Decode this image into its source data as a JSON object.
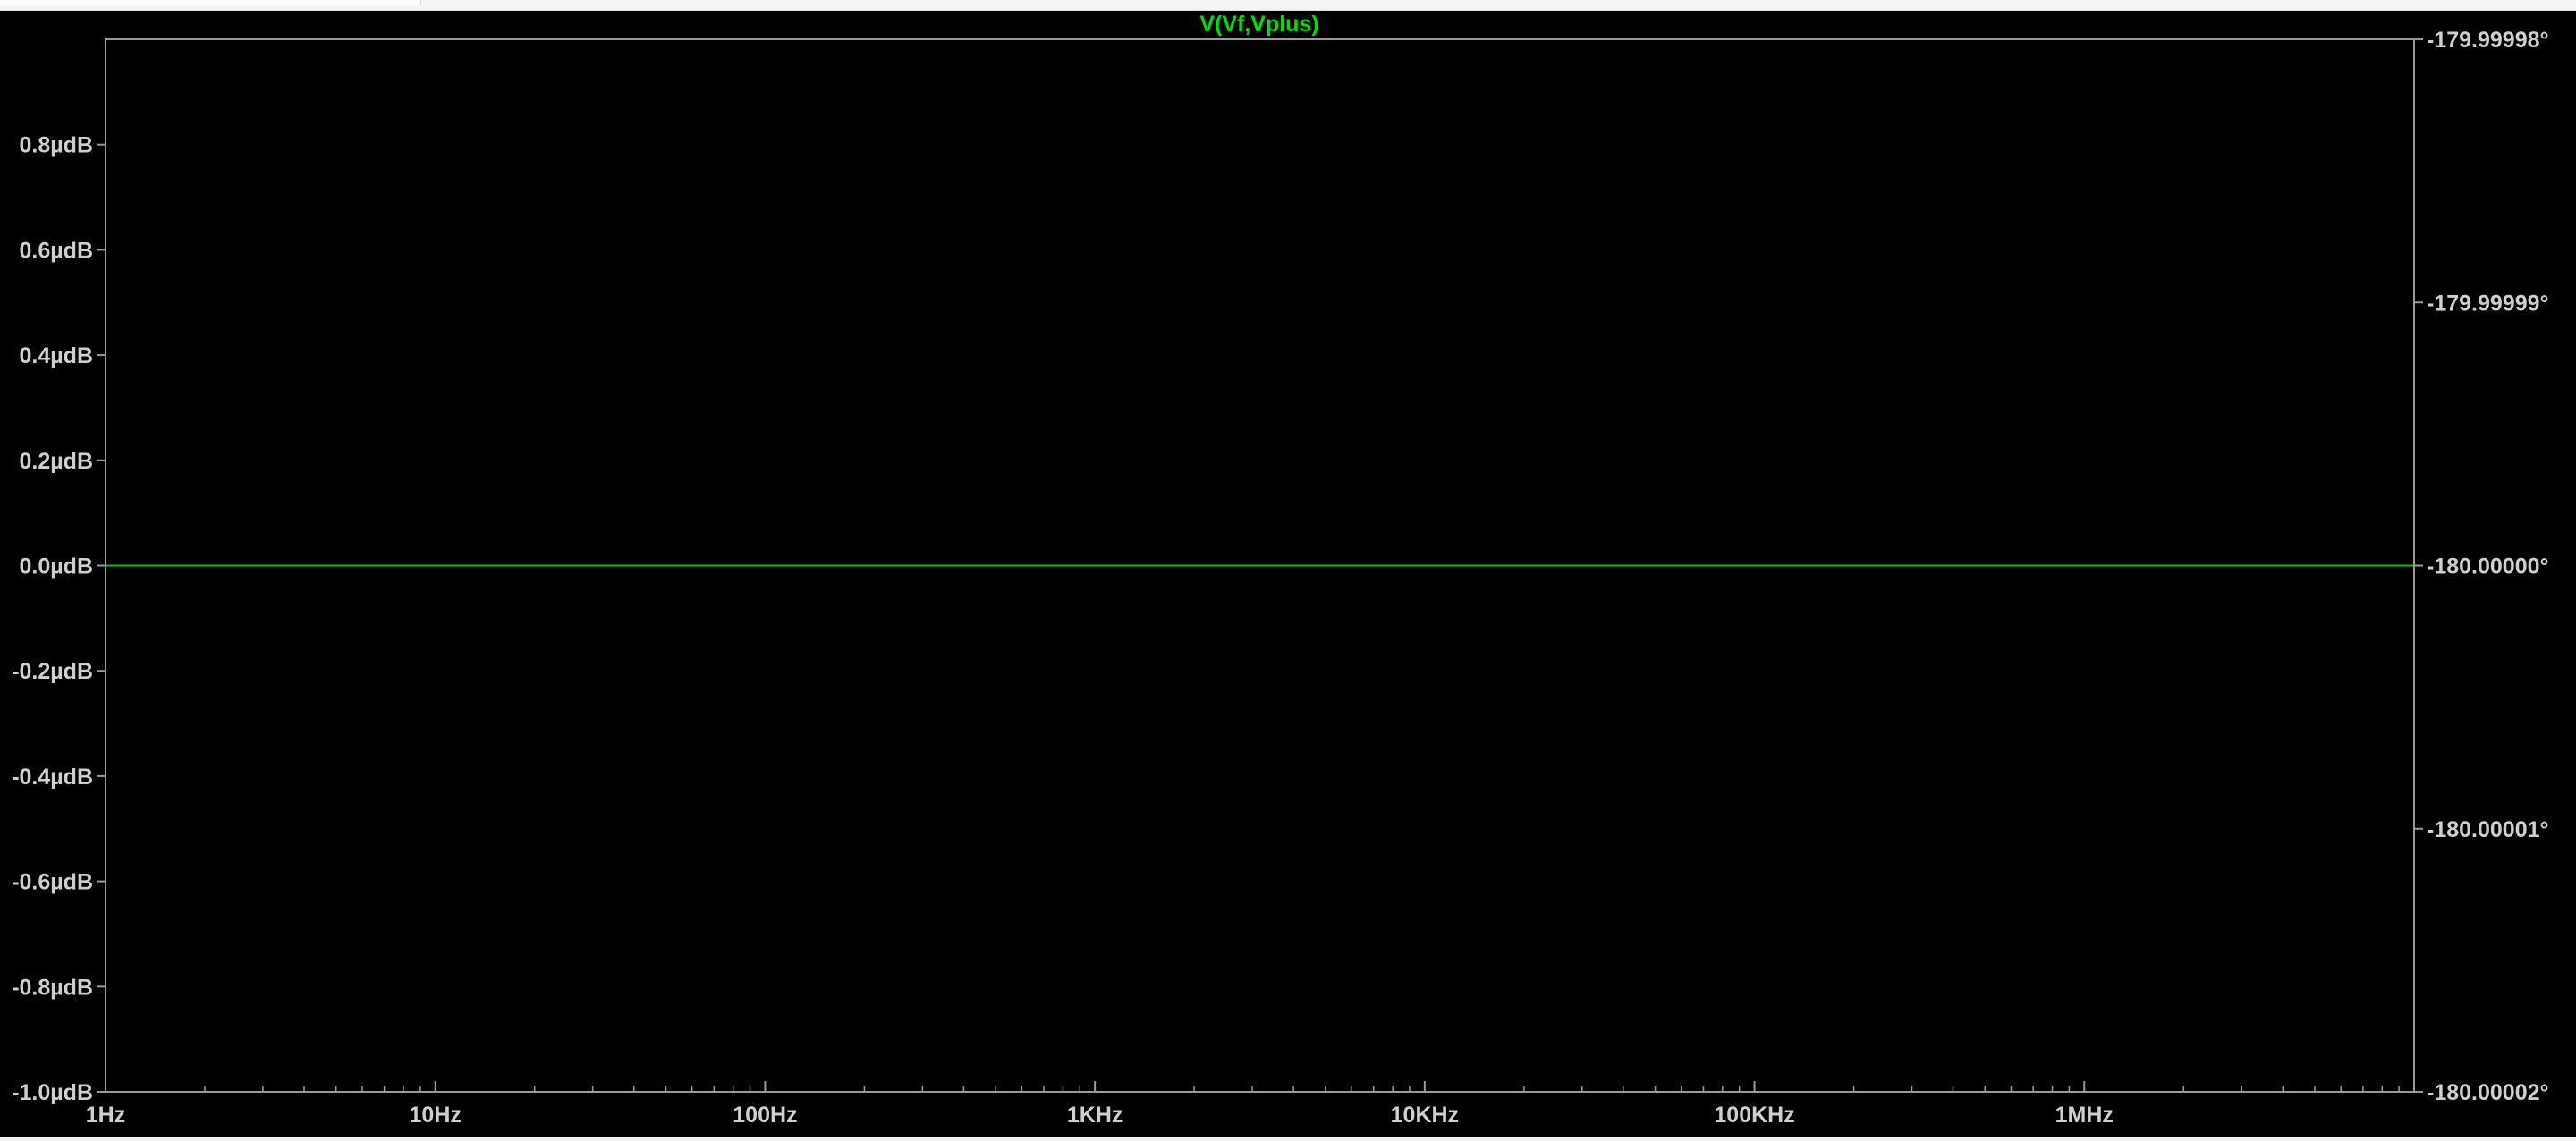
{
  "colors": {
    "background": "#000000",
    "frame": "#9a9a9a",
    "tick_label": "#cfcfcf",
    "trace": "#00c000",
    "trace_label": "#00e000"
  },
  "chart_data": {
    "type": "line",
    "title": "V(Vf,Vplus)",
    "x_scale": "log",
    "xlim": [
      1,
      10000000
    ],
    "x_ticks": [
      1,
      10,
      100,
      1000,
      10000,
      100000,
      1000000
    ],
    "x_tick_labels": [
      "1Hz",
      "10Hz",
      "100Hz",
      "1KHz",
      "10KHz",
      "100KHz",
      "1MHz"
    ],
    "y_left": {
      "unit": "µdB",
      "ylim": [
        -1.0,
        1.0
      ],
      "ticks": [
        0.8,
        0.6,
        0.4,
        0.2,
        0.0,
        -0.2,
        -0.4,
        -0.6,
        -0.8,
        -1.0
      ],
      "tick_labels": [
        "0.8µdB",
        "0.6µdB",
        "0.4µdB",
        "0.2µdB",
        "0.0µdB",
        "-0.2µdB",
        "-0.4µdB",
        "-0.6µdB",
        "-0.8µdB",
        "-1.0µdB"
      ]
    },
    "y_right": {
      "unit": "°",
      "ylim": [
        -180.00002,
        -179.99998
      ],
      "ticks": [
        -179.99998,
        -179.99999,
        -180.0,
        -180.00001,
        -180.00002
      ],
      "tick_labels": [
        "-179.99998°",
        "-179.99999°",
        "-180.00000°",
        "-180.00001°",
        "-180.00002°"
      ]
    },
    "grid": false,
    "series": [
      {
        "name": "V(Vf,Vplus)",
        "axis": "left",
        "x": [
          1,
          10000000
        ],
        "values": [
          0.0,
          0.0
        ]
      }
    ]
  }
}
